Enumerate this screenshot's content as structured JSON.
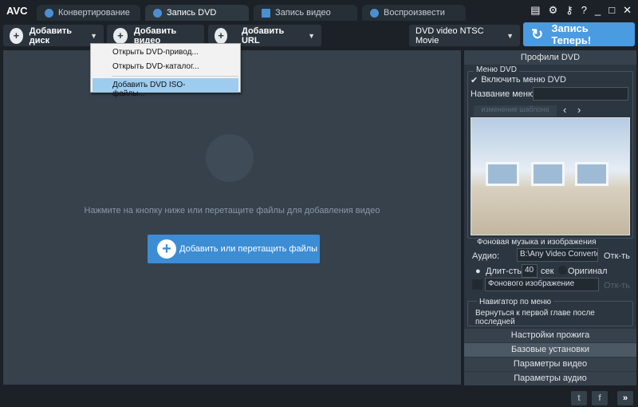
{
  "app": {
    "logo": "AVC"
  },
  "tabs": [
    {
      "label": "Конвертирование"
    },
    {
      "label": "Запись DVD"
    },
    {
      "label": "Запись видео"
    },
    {
      "label": "Воспроизвести"
    }
  ],
  "toolbar": {
    "add_disc": "Добавить диск",
    "add_video": "Добавить видео",
    "add_url": "Добавить URL",
    "profile": "DVD video NTSC Movie",
    "burn": "Запись Теперь!"
  },
  "menu": {
    "items": [
      "Открыть DVD-привод...",
      "Открыть DVD-каталог...",
      "Добавить DVD ISO-файлы..."
    ]
  },
  "main": {
    "hint": "Нажмите на кнопку ниже или перетащите файлы для добавления видео",
    "add_files": "Добавить или перетащить файлы"
  },
  "panel": {
    "title": "Профили DVD",
    "menu_group": "Меню DVD",
    "enable_menu": "Включить меню DVD",
    "menu_name_label": "Название меню:",
    "menu_name_value": "",
    "template_label": "изменение шаблона",
    "bg_group": "Фоновая музыка и изображения",
    "audio_label": "Аудио:",
    "audio_value": "B:\\Any Video Converter",
    "open": "Отк-ть",
    "duration_label": "Длит-сть:",
    "duration_value": "40",
    "sec": "сек",
    "original": "Оригинал",
    "bg_image": "Фонового изображение",
    "nav_group": "Навигатор по меню",
    "nav_value": "Вернуться к первой главе после последней",
    "sections": [
      "Настройки прожига",
      "Базовые установки",
      "Параметры видео",
      "Параметры аудио"
    ]
  },
  "footer": {
    "twitter": "t",
    "facebook": "f",
    "more": "»"
  },
  "colors": {
    "accent": "#3c8dd4",
    "menu_highlight": "#9dccef"
  }
}
